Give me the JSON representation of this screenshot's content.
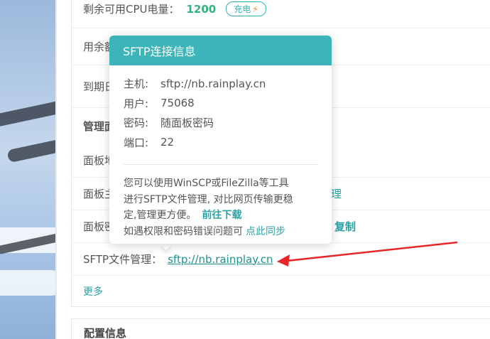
{
  "rows": {
    "cpu_label": "剩余可用CPU电量：",
    "cpu_value": "1200",
    "charge_label": "充电",
    "usage_label_partial": "用余额",
    "expire_label_partial": "到期日",
    "section_mgmt_partial": "管理面",
    "panel_addr_partial": "面板地",
    "panel_user_partial": "面板主",
    "panel_user_suffix": "理",
    "panel_pwd_partial": "面板密",
    "copy_label": "复制",
    "sftp_label": "SFTP文件管理：",
    "sftp_link": "sftp://nb.rainplay.cn",
    "more_label": "更多",
    "config_title": "配置信息"
  },
  "popover": {
    "title": "SFTP连接信息",
    "host_key": "主机:",
    "host_val": "sftp://nb.rainplay.cn",
    "user_key": "用户:",
    "user_val": "75068",
    "pwd_key": "密码:",
    "pwd_val": "随面板密码",
    "port_key": "端口:",
    "port_val": "22",
    "desc_line1": "您可以使用WinSCP或FileZilla等工具",
    "desc_line2": "进行SFTP文件管理, 对比网页传输更稳",
    "desc_line3": "定,管理更方便。",
    "download_link": "前往下载",
    "desc_line4": "如遇权限和密码错误问题可",
    "sync_link": "点此同步"
  },
  "colors": {
    "accent": "#3cb4b9",
    "link": "#2aa3a6",
    "value_green": "#33b27b",
    "annotation_red": "#e8262a"
  }
}
